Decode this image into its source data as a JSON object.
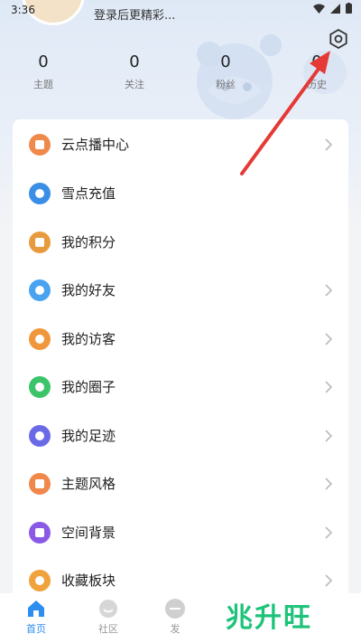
{
  "status_bar": {
    "time": "3:36"
  },
  "header": {
    "login_prompt": "登录后更精彩..."
  },
  "stats": [
    {
      "value": "0",
      "label": "主题"
    },
    {
      "value": "0",
      "label": "关注"
    },
    {
      "value": "0",
      "label": "粉丝"
    },
    {
      "value": "0",
      "label": "历史"
    }
  ],
  "menu": {
    "items": [
      {
        "label": "云点播中心",
        "icon": "video-center-icon",
        "color": "#f08a4b",
        "chevron": true
      },
      {
        "label": "雪点充值",
        "icon": "recharge-icon",
        "color": "#3a8ee6",
        "chevron": false
      },
      {
        "label": "我的积分",
        "icon": "points-icon",
        "color": "#e89b3c",
        "chevron": false
      },
      {
        "label": "我的好友",
        "icon": "friends-icon",
        "color": "#4aa3f0",
        "chevron": true
      },
      {
        "label": "我的访客",
        "icon": "visitors-icon",
        "color": "#f0963c",
        "chevron": true
      },
      {
        "label": "我的圈子",
        "icon": "circle-icon",
        "color": "#3cc46a",
        "chevron": true
      },
      {
        "label": "我的足迹",
        "icon": "footprint-icon",
        "color": "#6a6ae6",
        "chevron": true
      },
      {
        "label": "主题风格",
        "icon": "theme-icon",
        "color": "#f0884b",
        "chevron": true
      },
      {
        "label": "空间背景",
        "icon": "background-icon",
        "color": "#8a5ae6",
        "chevron": true
      },
      {
        "label": "收藏板块",
        "icon": "favorites-icon",
        "color": "#f0a33c",
        "chevron": true
      }
    ]
  },
  "bottom_nav": {
    "items": [
      {
        "label": "首页",
        "icon": "home-icon",
        "active": true
      },
      {
        "label": "社区",
        "icon": "community-icon",
        "active": false
      },
      {
        "label": "发",
        "icon": "post-icon",
        "active": false
      }
    ]
  },
  "watermark": "兆升旺",
  "colors": {
    "accent": "#2b8ef0",
    "annotation": "#e53935"
  }
}
